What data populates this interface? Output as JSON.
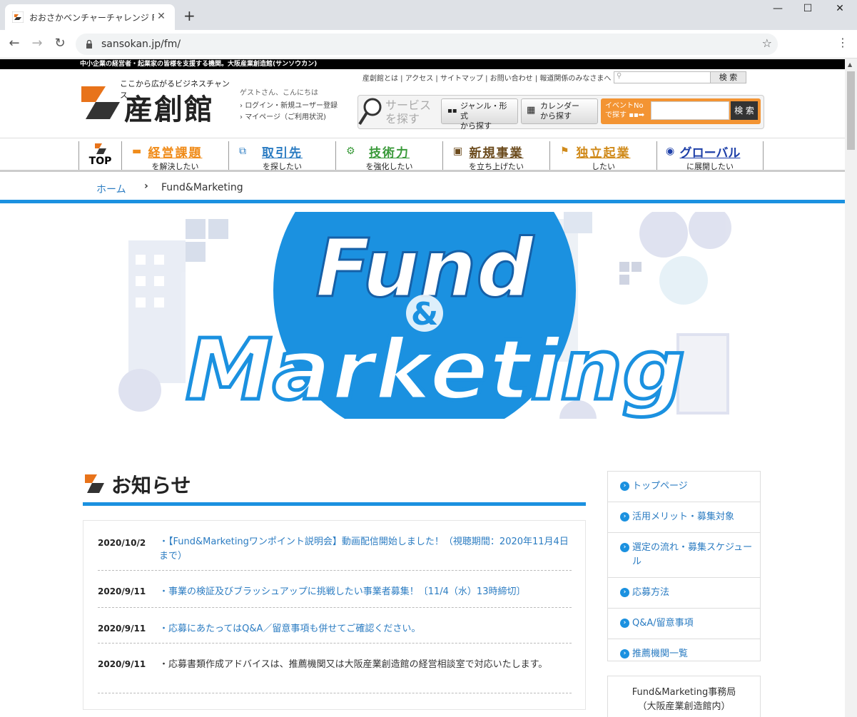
{
  "browser": {
    "tab_title": "おおさかベンチャーチャレンジ Fund&Marketing",
    "url": "sansokan.jp/fm/",
    "new_tab": "+",
    "close": "✕",
    "minimize": "—",
    "maximize": "☐",
    "window_close": "✕"
  },
  "site": {
    "topbar": "中小企業の経営者・起業家の皆様を支援する機関。大阪産業創造館(サンソウカン)",
    "tagline": "ここから広がるビジネスチャンス",
    "logo_text": "産創館",
    "guest": "ゲストさん、こんにちは",
    "login_link": "ログイン・新規ユーザー登録",
    "mypage_link": "マイページ（ご利用状況)",
    "util_links": "産創館とは | アクセス | サイトマップ | お問い合わせ | 報道関係のみなさまへ |",
    "util_search_btn": "検 索",
    "service_label_1": "サービス",
    "service_label_2": "を探す",
    "genre_btn_1": "ジャンル・形式",
    "genre_btn_2": "から探す",
    "calendar_btn_1": "カレンダー",
    "calendar_btn_2": "から探す",
    "event_label_1": "イベントNo",
    "event_label_2": "で探す",
    "event_search_btn": "検 索"
  },
  "gnav": {
    "top": "TOP",
    "items": [
      {
        "main": "経営課題",
        "sub": "を解決したい",
        "color": "#f08c1a"
      },
      {
        "main": "取引先",
        "sub": "を探したい",
        "color": "#2b7cc2"
      },
      {
        "main": "技術力",
        "sub": "を強化したい",
        "color": "#3a9a3a"
      },
      {
        "main": "新規事業",
        "sub": "を立ち上げたい",
        "color": "#6b4a1c"
      },
      {
        "main": "独立起業",
        "sub": "したい",
        "color": "#d08a1a"
      },
      {
        "main": "グローバル",
        "sub": "に展開したい",
        "color": "#1d3fa8"
      }
    ]
  },
  "breadcrumb": {
    "home": "ホーム",
    "separator": "›",
    "current": "Fund&Marketing"
  },
  "hero": {
    "line1": "Fund",
    "amp": "&",
    "line2": "Marketing",
    "circle_color": "#1b91e0"
  },
  "news": {
    "title": "お知らせ",
    "items": [
      {
        "date": "2020/10/2",
        "text": "・【Fund&Marketingワンポイント説明会】動画配信開始しました！（視聴期間：2020年11月4日まで）",
        "link": true
      },
      {
        "date": "2020/9/11",
        "text": "・事業の検証及びブラッシュアップに挑戦したい事業者募集！〔11/4（水）13時締切〕",
        "link": true
      },
      {
        "date": "2020/9/11",
        "text": "・応募にあたってはQ&A／留意事項も併せてご確認ください。",
        "link": true
      },
      {
        "date": "2020/9/11",
        "text": "・応募書類作成アドバイスは、推薦機関又は大阪産業創造館の経営相談室で対応いたします。",
        "link": false
      }
    ]
  },
  "sidebar": {
    "items": [
      "トップページ",
      "活用メリット・募集対象",
      "選定の流れ・募集スケジュール",
      "応募方法",
      "Q&A/留意事項",
      "推薦機関一覧"
    ],
    "office_line1": "Fund&Marketing事務局",
    "office_line2": "（大阪産業創造館内）"
  },
  "colors": {
    "accent": "#1b91e0",
    "link": "#2b7cc2",
    "orange": "#f39433"
  }
}
